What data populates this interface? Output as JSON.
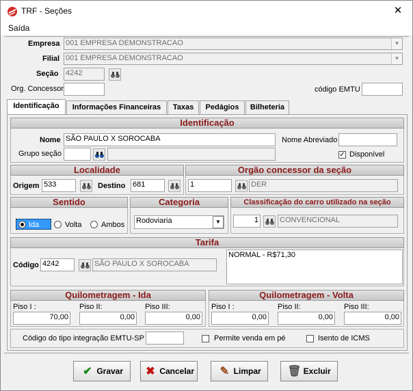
{
  "window": {
    "title": "TRF - Seções",
    "close": "✕"
  },
  "menu": {
    "saida": "Saída"
  },
  "header": {
    "empresa_label": "Empresa",
    "empresa_value": "001 EMPRESA DEMONSTRACAO",
    "filial_label": "Filial",
    "filial_value": "001 EMPRESA DEMONSTRACAO",
    "secao_label": "Seção",
    "secao_value": "4242",
    "org_label": "Org. Concessor",
    "org_value": "",
    "emtu_label": "código EMTU",
    "emtu_value": ""
  },
  "tabs": [
    "Identificação",
    "Informações Financeiras",
    "Taxas",
    "Pedágios",
    "Bilheteria"
  ],
  "identificacao": {
    "header": "Identificação",
    "nome_label": "Nome",
    "nome_value": "SÃO PAULO X SOROCABA",
    "nome_abrev_label": "Nome Abreviado",
    "nome_abrev_value": "",
    "grupo_label": "Grupo seção",
    "grupo_value": "",
    "grupo_desc": "",
    "disponivel_label": "Disponível",
    "disponivel_checked": true
  },
  "localidade": {
    "header": "Localidade",
    "origem_label": "Origem",
    "origem_value": "533",
    "destino_label": "Destino",
    "destino_value": "681"
  },
  "orgao": {
    "header": "Orgão concessor da seção",
    "code": "1",
    "desc": "DER"
  },
  "sentido": {
    "header": "Sentido",
    "options": [
      "Ida",
      "Volta",
      "Ambos"
    ],
    "selected": "Ida"
  },
  "categoria": {
    "header": "Categoria",
    "value": "Rodoviaria"
  },
  "classificacao": {
    "header": "Classificação do carro utilizado na seção",
    "code": "1",
    "desc": "CONVENCIONAL"
  },
  "tarifa": {
    "header": "Tarifa",
    "codigo_label": "Código",
    "codigo_value": "4242",
    "codigo_desc": "SÃO PAULO X SOROCABA",
    "list_text": "NORMAL -  R$71,30"
  },
  "km_ida": {
    "header": "Quilometragem - Ida",
    "piso1_label": "Piso I :",
    "piso1_value": "70,00",
    "piso2_label": "Piso II:",
    "piso2_value": "0,00",
    "piso3_label": "Piso III:",
    "piso3_value": "0,00"
  },
  "km_volta": {
    "header": "Quilometragem - Volta",
    "piso1_label": "Piso I :",
    "piso1_value": "0,00",
    "piso2_label": "Piso II:",
    "piso2_value": "0,00",
    "piso3_label": "Piso III:",
    "piso3_value": "0,00"
  },
  "bottom_row": {
    "emtu_sp_label": "Código do tipo integração EMTU-SP",
    "emtu_sp_value": "",
    "venda_pe_label": "Permite venda em pé",
    "isento_label": "Isento de ICMS"
  },
  "buttons": {
    "gravar": "Gravar",
    "cancelar": "Cancelar",
    "limpar": "Limpar",
    "excluir": "Excluir"
  },
  "colors": {
    "section_title": "#8b1a1a",
    "accent_gravar": "#1a8a1a",
    "accent_cancelar": "#c01010"
  }
}
